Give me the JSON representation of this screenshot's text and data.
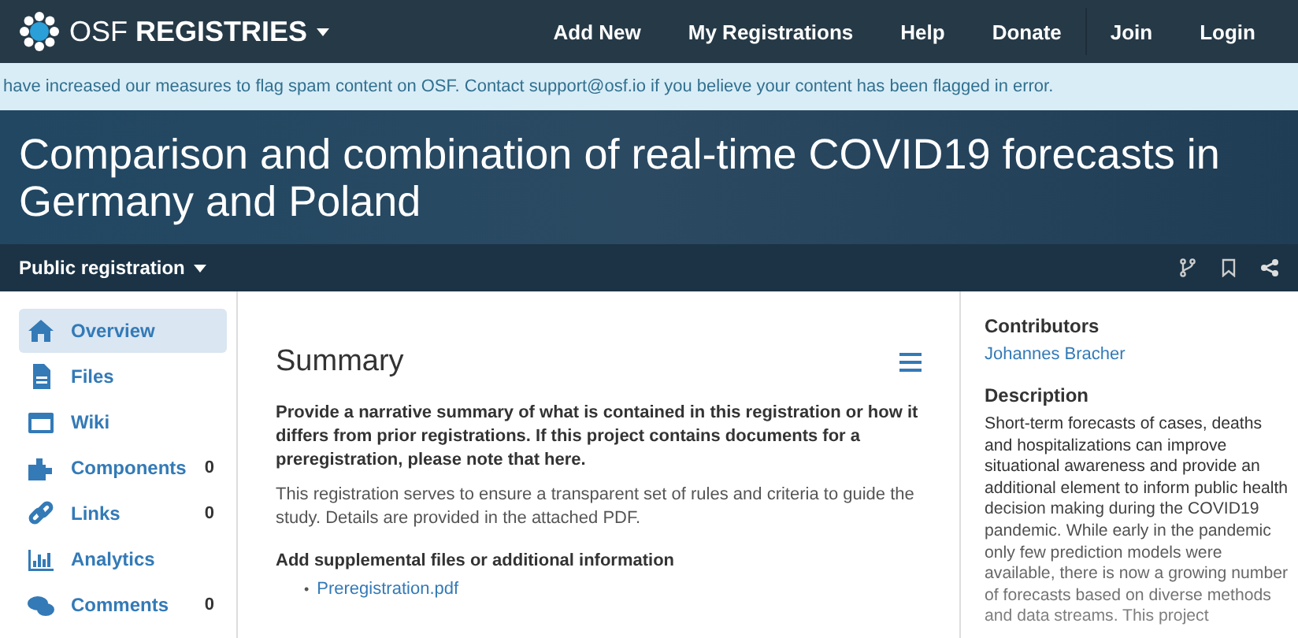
{
  "navbar": {
    "brand_light": "OSF",
    "brand_bold": "REGISTRIES",
    "links": [
      {
        "label": "Add New"
      },
      {
        "label": "My Registrations"
      },
      {
        "label": "Help"
      },
      {
        "label": "Donate"
      },
      {
        "label": "Join"
      },
      {
        "label": "Login"
      }
    ]
  },
  "alert": {
    "text": "have increased our measures to flag spam content on OSF. Contact support@osf.io if you believe your content has been flagged in error."
  },
  "title": "Comparison and combination of real-time COVID19 forecasts in Germany and Poland",
  "subnav": {
    "label": "Public registration"
  },
  "sidebar": {
    "items": [
      {
        "kind": "home",
        "label": "Overview",
        "selected": true
      },
      {
        "kind": "file",
        "label": "Files",
        "selected": false
      },
      {
        "kind": "wiki",
        "label": "Wiki",
        "selected": false
      },
      {
        "kind": "components",
        "label": "Components",
        "count": "0",
        "selected": false
      },
      {
        "kind": "links",
        "label": "Links",
        "count": "0",
        "selected": false
      },
      {
        "kind": "analytics",
        "label": "Analytics",
        "selected": false
      },
      {
        "kind": "comments",
        "label": "Comments",
        "count": "0",
        "selected": false
      }
    ]
  },
  "summary": {
    "heading": "Summary",
    "prompt": "Provide a narrative summary of what is contained in this registration or how it differs from prior registrations. If this project contains documents for a preregistration, please note that here.",
    "answer": "This registration serves to ensure a transparent set of rules and criteria to guide the study. Details are provided in the attached PDF.",
    "supplement_heading": "Add supplemental files or additional information",
    "file_bullet": "•",
    "files": [
      "Preregistration.pdf"
    ]
  },
  "contributors": {
    "heading": "Contributors",
    "names": [
      "Johannes Bracher"
    ]
  },
  "description": {
    "heading": "Description",
    "text": "Short-term forecasts of cases, deaths and hospitalizations can improve situational awareness and provide an additional element to inform public health decision making during the COVID19 pandemic. While early in the pandemic only few prediction models were available, there is now a growing number of forecasts based on diverse methods and data streams. This project"
  }
}
